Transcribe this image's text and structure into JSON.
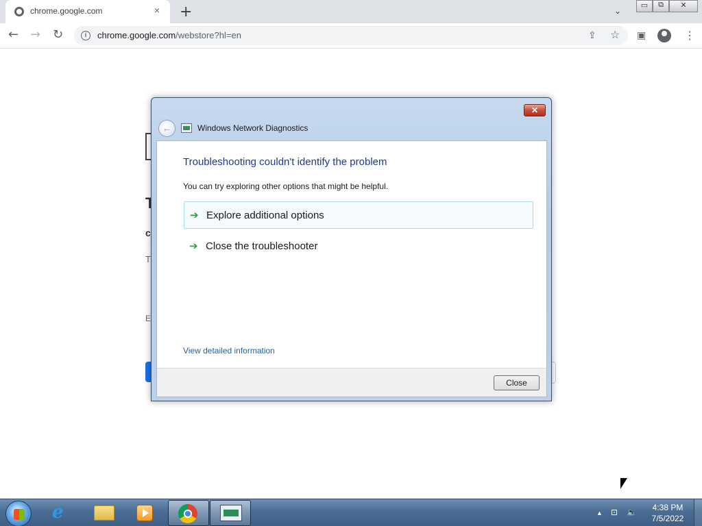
{
  "browser": {
    "tab_title": "chrome.google.com",
    "tab_close": "×",
    "new_tab": "+",
    "tab_search": "⌄",
    "url_host": "chrome.google.com",
    "url_path": "/webstore?hl=en",
    "back": "←",
    "forward": "→",
    "reload": "↻",
    "share": "⇪",
    "star": "☆",
    "sidepanel": "▣",
    "menu": "⋮",
    "minimize": "▭",
    "restore": "⧉",
    "close": "✕"
  },
  "page_fragments": {
    "t": "T",
    "c": "c",
    "t2": "T",
    "e": "E"
  },
  "dialog": {
    "title": "Windows Network Diagnostics",
    "close_glyph": "✕",
    "back_glyph": "←",
    "heading": "Troubleshooting couldn't identify the problem",
    "hint": "You can try exploring other options that might be helpful.",
    "options": [
      {
        "label": "Explore additional options",
        "arrow": "➔"
      },
      {
        "label": "Close the troubleshooter",
        "arrow": "➔"
      }
    ],
    "detail_link": "View detailed information",
    "close_button": "Close"
  },
  "taskbar": {
    "ie_glyph": "e",
    "tray_up": "▲",
    "tray_network": "⊡",
    "tray_volume": "🔈",
    "time": "4:38 PM",
    "date": "7/5/2022"
  }
}
